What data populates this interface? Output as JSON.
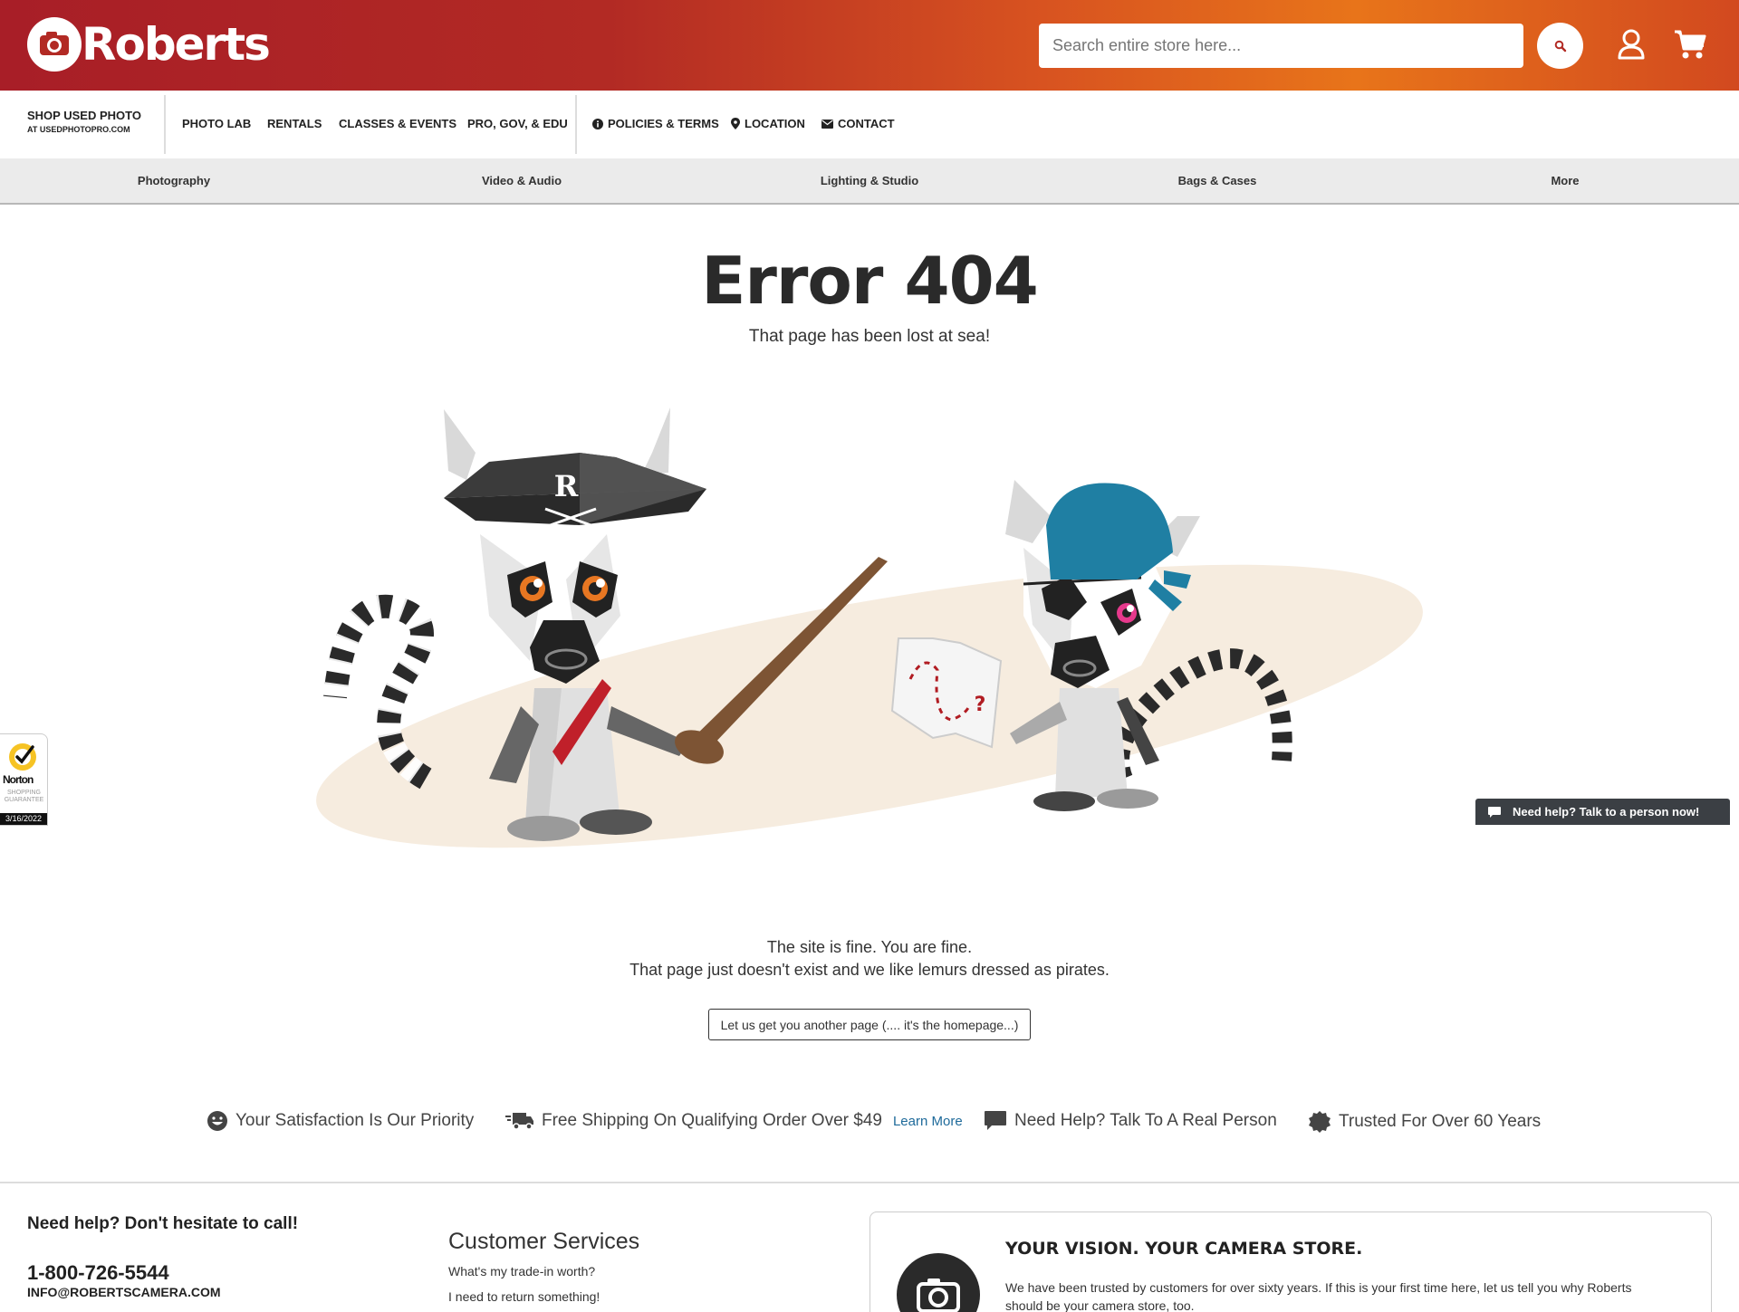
{
  "header": {
    "logo_text": "Roberts",
    "search_placeholder": "Search entire store here..."
  },
  "subnav": {
    "shop_used_line1": "SHOP USED PHOTO",
    "shop_used_line2": "AT USEDPHOTOPRO.COM",
    "links": [
      "PHOTO LAB",
      "RENTALS",
      "CLASSES & EVENTS",
      "PRO, GOV, & EDU"
    ],
    "policies": "POLICIES & TERMS",
    "location": "LOCATION",
    "contact": "CONTACT"
  },
  "categories": [
    "Photography",
    "Video & Audio",
    "Lighting & Studio",
    "Bags & Cases",
    "More"
  ],
  "error": {
    "title": "Error 404",
    "subtitle": "That page has been lost at sea!",
    "hat_letter": "R",
    "map_mark": "?",
    "message_line1": "The site is fine. You are fine.",
    "message_line2": "That page just doesn't exist and we like lemurs dressed as pirates.",
    "home_button": "Let us get you another page (.... it's the homepage...)"
  },
  "norton": {
    "brand": "Norton",
    "sub": "SHOPPING GUARANTEE",
    "date": "3/16/2022"
  },
  "chat": {
    "label": "Need help? Talk to a person now!"
  },
  "features": {
    "satisfaction": "Your Satisfaction Is Our Priority",
    "shipping": "Free Shipping On Qualifying Order Over $49",
    "learn_more": "Learn More",
    "help": "Need Help? Talk To A Real Person",
    "trusted": "Trusted For Over 60 Years"
  },
  "footer": {
    "help_title": "Need help? Don't hesitate to call!",
    "phone": "1-800-726-5544",
    "email": "INFO@ROBERTSCAMERA.COM",
    "cs_title": "Customer Services",
    "cs_links": [
      "What's my trade-in worth?",
      "I need to return something!"
    ],
    "vision_title": "YOUR VISION. YOUR CAMERA STORE.",
    "vision_text": "We have been trusted by customers for over sixty years. If this is your first time here, let us tell you why Roberts should be your camera store, too."
  },
  "colors": {
    "brand_red": "#a81e27",
    "brand_orange": "#e8741a",
    "link_blue": "#1e6a9a",
    "bandana_teal": "#1f7fa3",
    "sash_red": "#c0202a",
    "sand": "#f6ecdf"
  }
}
